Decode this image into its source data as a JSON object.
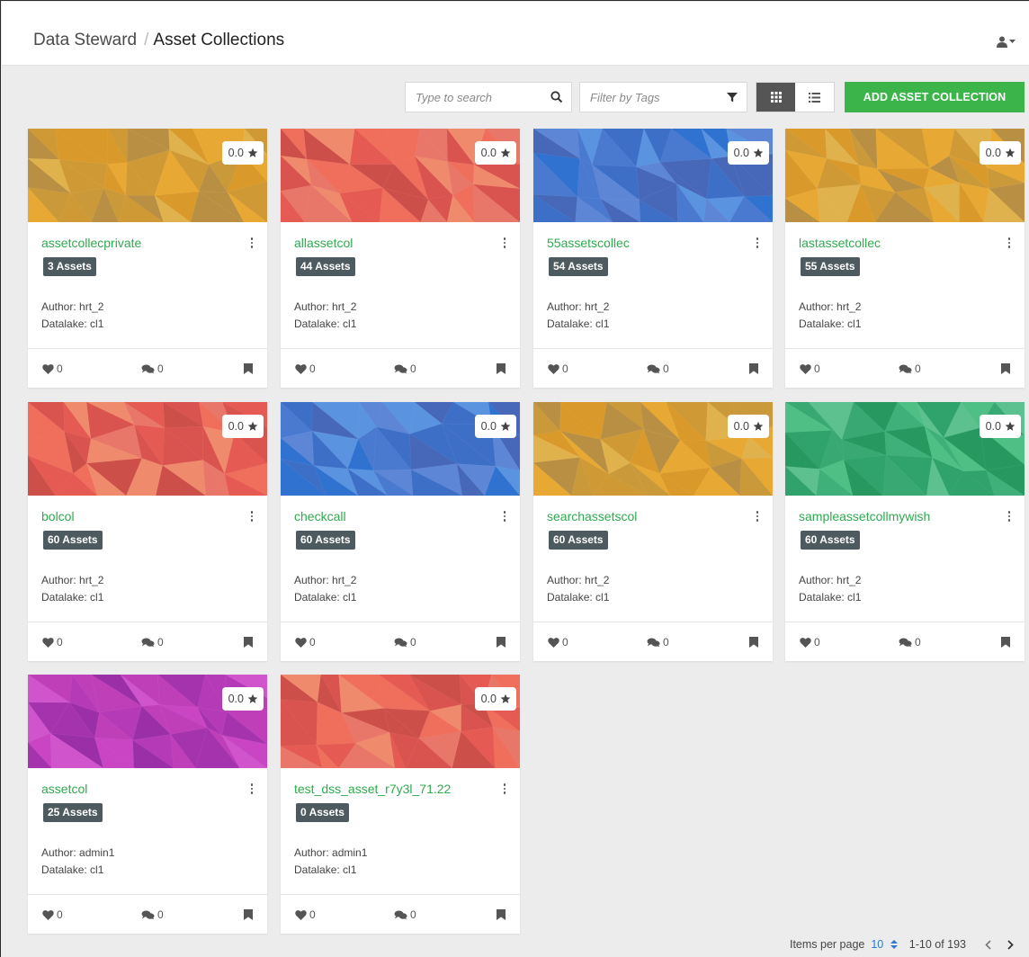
{
  "breadcrumb": {
    "root": "Data Steward",
    "separator": "/",
    "current": "Asset Collections"
  },
  "user_menu": {
    "icon": "user-icon",
    "caret": "caret-down-icon"
  },
  "toolbar": {
    "search_placeholder": "Type to search",
    "tags_placeholder": "Filter by Tags",
    "view_modes": [
      "grid-view-icon",
      "list-view-icon"
    ],
    "active_view": "grid",
    "add_button_label": "ADD ASSET COLLECTION"
  },
  "colors": {
    "accent_green": "#3bb44a",
    "title_green": "#2faa4f",
    "badge": "#4d5a5f",
    "link_blue": "#2a7bd1"
  },
  "collections": [
    {
      "rating": "0.0",
      "title": "assetcollecprivate",
      "assets": "3 Assets",
      "author": "Author: hrt_2",
      "datalake": "Datalake: cl1",
      "likes": "0",
      "comments": "0",
      "palette": "gold"
    },
    {
      "rating": "0.0",
      "title": "allassetcol",
      "assets": "44 Assets",
      "author": "Author: hrt_2",
      "datalake": "Datalake: cl1",
      "likes": "0",
      "comments": "0",
      "palette": "red"
    },
    {
      "rating": "0.0",
      "title": "55assetscollec",
      "assets": "54 Assets",
      "author": "Author: hrt_2",
      "datalake": "Datalake: cl1",
      "likes": "0",
      "comments": "0",
      "palette": "blue"
    },
    {
      "rating": "0.0",
      "title": "lastassetcollec",
      "assets": "55 Assets",
      "author": "Author: hrt_2",
      "datalake": "Datalake: cl1",
      "likes": "0",
      "comments": "0",
      "palette": "gold"
    },
    {
      "rating": "0.0",
      "title": "bolcol",
      "assets": "60 Assets",
      "author": "Author: hrt_2",
      "datalake": "Datalake: cl1",
      "likes": "0",
      "comments": "0",
      "palette": "red"
    },
    {
      "rating": "0.0",
      "title": "checkcall",
      "assets": "60 Assets",
      "author": "Author: hrt_2",
      "datalake": "Datalake: cl1",
      "likes": "0",
      "comments": "0",
      "palette": "blue"
    },
    {
      "rating": "0.0",
      "title": "searchassetscol",
      "assets": "60 Assets",
      "author": "Author: hrt_2",
      "datalake": "Datalake: cl1",
      "likes": "0",
      "comments": "0",
      "palette": "gold"
    },
    {
      "rating": "0.0",
      "title": "sampleassetcollmywish",
      "assets": "60 Assets",
      "author": "Author: hrt_2",
      "datalake": "Datalake: cl1",
      "likes": "0",
      "comments": "0",
      "palette": "green"
    },
    {
      "rating": "0.0",
      "title": "assetcol",
      "assets": "25 Assets",
      "author": "Author: admin1",
      "datalake": "Datalake: cl1",
      "likes": "0",
      "comments": "0",
      "palette": "magenta"
    },
    {
      "rating": "0.0",
      "title": "test_dss_asset_r7y3l_71.22",
      "assets": "0 Assets",
      "author": "Author: admin1",
      "datalake": "Datalake: cl1",
      "likes": "0",
      "comments": "0",
      "palette": "red"
    }
  ],
  "palettes": {
    "gold": [
      "#e8a934",
      "#d99a2b",
      "#c9993a",
      "#b99043",
      "#e0b24e",
      "#cf9a36"
    ],
    "red": [
      "#ef6e5c",
      "#e55a52",
      "#d9534f",
      "#e8776a",
      "#cc4f4a",
      "#f08a6c"
    ],
    "blue": [
      "#5d86d6",
      "#4a79d0",
      "#3d6fc7",
      "#5a94e0",
      "#4767b8",
      "#2f72d0"
    ],
    "green": [
      "#3fb07a",
      "#2fa36b",
      "#4fbf86",
      "#279860",
      "#39a872",
      "#5cc08f"
    ],
    "magenta": [
      "#c945c4",
      "#b53ab8",
      "#a533ad",
      "#d055cc",
      "#bf3fb9",
      "#9a2fa8"
    ]
  },
  "pagination": {
    "items_per_page_label": "Items per page",
    "items_per_page_value": "10",
    "range": "1-10 of 193"
  }
}
